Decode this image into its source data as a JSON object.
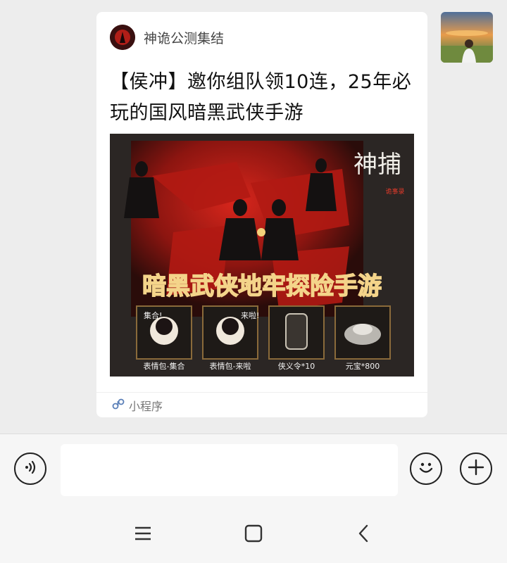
{
  "card": {
    "source_name": "神诡公测集结",
    "title": "【侯冲】邀你组队领10连，25年必玩的国风暗黑武侠手游",
    "footer_label": "小程序",
    "banner": {
      "logo_text": "神捕",
      "logo_sub": "诡事录",
      "tagline": "暗黑武侠地牢探险手游",
      "rewards": [
        {
          "label": "表情包-集合",
          "badge": "集合!"
        },
        {
          "label": "表情包-来啦",
          "badge": "来啦!"
        },
        {
          "label": "侠义令*10",
          "badge": ""
        },
        {
          "label": "元宝*800",
          "badge": ""
        }
      ]
    }
  },
  "input_bar": {
    "voice_icon": "voice-icon",
    "emoji_icon": "emoji-icon",
    "plus_icon": "plus-icon",
    "message_value": ""
  },
  "nav_bar": {
    "menu_icon": "menu-icon",
    "home_icon": "home-square-icon",
    "back_icon": "back-chevron-icon"
  },
  "colors": {
    "chat_bg": "#ededed",
    "card_bg": "#ffffff",
    "banner_red": "#c8231b",
    "tagline_red": "#e21b12"
  }
}
